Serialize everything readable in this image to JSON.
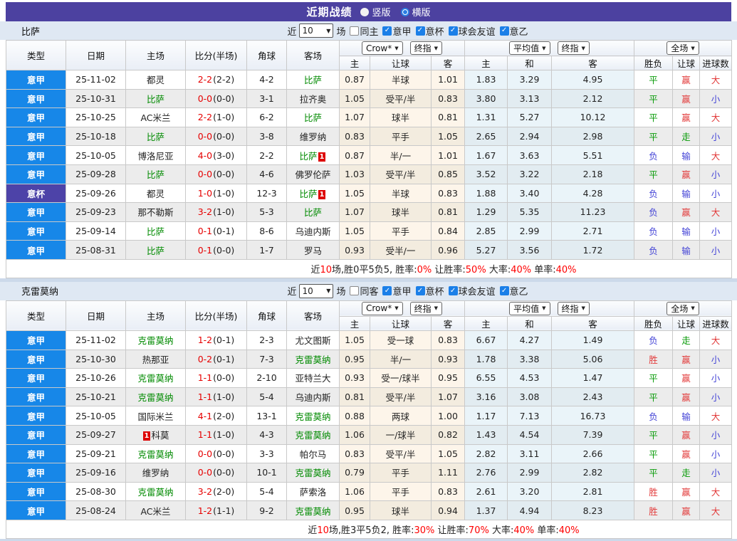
{
  "title_bar": {
    "title": "近期战绩",
    "radios": [
      {
        "label": "竖版",
        "checked": false,
        "name": "vertical-layout-radio"
      },
      {
        "label": "横版",
        "checked": true,
        "name": "horizontal-layout-radio"
      }
    ]
  },
  "colors": {
    "header_purple": "#4c41a0",
    "league_serie_a_blue": "#1787e8",
    "league_cup_purple": "#4d43a8",
    "focal_team_green": "#008a00",
    "score_red": "#e60000",
    "outcome_red": "#e23b3b",
    "outcome_green": "#089b08",
    "outcome_blue": "#4343d6",
    "outcome_map": {
      "胜": "r",
      "赢": "r",
      "大": "r",
      "平": "g",
      "走": "g",
      "负": "b",
      "输": "b",
      "小": "b"
    }
  },
  "tables": [
    {
      "team": "比萨",
      "filter": {
        "near_label": "近",
        "count": "10",
        "games_label": "场",
        "same_label": "同主",
        "leagues": [
          "意甲",
          "意杯",
          "球会友谊",
          "意乙"
        ]
      },
      "header": {
        "cols": [
          "类型",
          "日期",
          "主场",
          "比分(半场)",
          "角球",
          "客场"
        ],
        "dd": [
          "Crow*",
          "终指",
          "平均值",
          "终指",
          "全场"
        ],
        "sub": [
          "主",
          "让球",
          "客",
          "主",
          "和",
          "客",
          "胜负",
          "让球",
          "进球数"
        ]
      },
      "rows": [
        {
          "league": "意甲",
          "date": "25-11-02",
          "home": {
            "name": "都灵"
          },
          "ft": "2-2",
          "ht": "(2-2)",
          "corner": "4-2",
          "away": {
            "name": "比萨",
            "focal": true
          },
          "crow": [
            "0.87",
            "半球",
            "1.01"
          ],
          "avg": [
            "1.83",
            "3.29",
            "4.95"
          ],
          "full": [
            "平",
            "赢",
            "大"
          ]
        },
        {
          "league": "意甲",
          "date": "25-10-31",
          "home": {
            "name": "比萨",
            "focal": true
          },
          "ft": "0-0",
          "ht": "(0-0)",
          "corner": "3-1",
          "away": {
            "name": "拉齐奥"
          },
          "crow": [
            "1.05",
            "受平/半",
            "0.83"
          ],
          "avg": [
            "3.80",
            "3.13",
            "2.12"
          ],
          "full": [
            "平",
            "赢",
            "小"
          ]
        },
        {
          "league": "意甲",
          "date": "25-10-25",
          "home": {
            "name": "AC米兰"
          },
          "ft": "2-2",
          "ht": "(1-0)",
          "corner": "6-2",
          "away": {
            "name": "比萨",
            "focal": true
          },
          "crow": [
            "1.07",
            "球半",
            "0.81"
          ],
          "avg": [
            "1.31",
            "5.27",
            "10.12"
          ],
          "full": [
            "平",
            "赢",
            "大"
          ]
        },
        {
          "league": "意甲",
          "date": "25-10-18",
          "home": {
            "name": "比萨",
            "focal": true
          },
          "ft": "0-0",
          "ht": "(0-0)",
          "corner": "3-8",
          "away": {
            "name": "维罗纳"
          },
          "crow": [
            "0.83",
            "平手",
            "1.05"
          ],
          "avg": [
            "2.65",
            "2.94",
            "2.98"
          ],
          "full": [
            "平",
            "走",
            "小"
          ]
        },
        {
          "league": "意甲",
          "date": "25-10-05",
          "home": {
            "name": "博洛尼亚"
          },
          "ft": "4-0",
          "ht": "(3-0)",
          "corner": "2-2",
          "away": {
            "name": "比萨",
            "focal": true,
            "badge": "1",
            "badge_pos": "after"
          },
          "crow": [
            "0.87",
            "半/一",
            "1.01"
          ],
          "avg": [
            "1.67",
            "3.63",
            "5.51"
          ],
          "full": [
            "负",
            "输",
            "大"
          ]
        },
        {
          "league": "意甲",
          "date": "25-09-28",
          "home": {
            "name": "比萨",
            "focal": true
          },
          "ft": "0-0",
          "ht": "(0-0)",
          "corner": "4-6",
          "away": {
            "name": "佛罗伦萨"
          },
          "crow": [
            "1.03",
            "受平/半",
            "0.85"
          ],
          "avg": [
            "3.52",
            "3.22",
            "2.18"
          ],
          "full": [
            "平",
            "赢",
            "小"
          ]
        },
        {
          "league": "意杯",
          "date": "25-09-26",
          "home": {
            "name": "都灵"
          },
          "ft": "1-0",
          "ht": "(1-0)",
          "corner": "12-3",
          "away": {
            "name": "比萨",
            "focal": true,
            "badge": "1",
            "badge_pos": "after"
          },
          "crow": [
            "1.05",
            "半球",
            "0.83"
          ],
          "avg": [
            "1.88",
            "3.40",
            "4.28"
          ],
          "full": [
            "负",
            "输",
            "小"
          ]
        },
        {
          "league": "意甲",
          "date": "25-09-23",
          "home": {
            "name": "那不勒斯"
          },
          "ft": "3-2",
          "ht": "(1-0)",
          "corner": "5-3",
          "away": {
            "name": "比萨",
            "focal": true
          },
          "crow": [
            "1.07",
            "球半",
            "0.81"
          ],
          "avg": [
            "1.29",
            "5.35",
            "11.23"
          ],
          "full": [
            "负",
            "赢",
            "大"
          ]
        },
        {
          "league": "意甲",
          "date": "25-09-14",
          "home": {
            "name": "比萨",
            "focal": true
          },
          "ft": "0-1",
          "ht": "(0-1)",
          "corner": "8-6",
          "away": {
            "name": "乌迪内斯"
          },
          "crow": [
            "1.05",
            "平手",
            "0.84"
          ],
          "avg": [
            "2.85",
            "2.99",
            "2.71"
          ],
          "full": [
            "负",
            "输",
            "小"
          ]
        },
        {
          "league": "意甲",
          "date": "25-08-31",
          "home": {
            "name": "比萨",
            "focal": true
          },
          "ft": "0-1",
          "ht": "(0-0)",
          "corner": "1-7",
          "away": {
            "name": "罗马"
          },
          "crow": [
            "0.93",
            "受半/一",
            "0.96"
          ],
          "avg": [
            "5.27",
            "3.56",
            "1.72"
          ],
          "full": [
            "负",
            "输",
            "小"
          ]
        }
      ],
      "summary": [
        {
          "t": "近",
          "red": false
        },
        {
          "t": "10",
          "red": true
        },
        {
          "t": "场,胜0平5负5, 胜率:",
          "red": false
        },
        {
          "t": "0%",
          "red": true
        },
        {
          "t": " 让胜率:",
          "red": false
        },
        {
          "t": "50%",
          "red": true
        },
        {
          "t": " 大率:",
          "red": false
        },
        {
          "t": "40%",
          "red": true
        },
        {
          "t": " 单率:",
          "red": false
        },
        {
          "t": "40%",
          "red": true
        }
      ]
    },
    {
      "team": "克雷莫纳",
      "filter": {
        "near_label": "近",
        "count": "10",
        "games_label": "场",
        "same_label": "同客",
        "leagues": [
          "意甲",
          "意杯",
          "球会友谊",
          "意乙"
        ]
      },
      "header": {
        "cols": [
          "类型",
          "日期",
          "主场",
          "比分(半场)",
          "角球",
          "客场"
        ],
        "dd": [
          "Crow*",
          "终指",
          "平均值",
          "终指",
          "全场"
        ],
        "sub": [
          "主",
          "让球",
          "客",
          "主",
          "和",
          "客",
          "胜负",
          "让球",
          "进球数"
        ]
      },
      "rows": [
        {
          "league": "意甲",
          "date": "25-11-02",
          "home": {
            "name": "克雷莫纳",
            "focal": true
          },
          "ft": "1-2",
          "ht": "(0-1)",
          "corner": "2-3",
          "away": {
            "name": "尤文图斯"
          },
          "crow": [
            "1.05",
            "受一球",
            "0.83"
          ],
          "avg": [
            "6.67",
            "4.27",
            "1.49"
          ],
          "full": [
            "负",
            "走",
            "大"
          ]
        },
        {
          "league": "意甲",
          "date": "25-10-30",
          "home": {
            "name": "热那亚"
          },
          "ft": "0-2",
          "ht": "(0-1)",
          "corner": "7-3",
          "away": {
            "name": "克雷莫纳",
            "focal": true
          },
          "crow": [
            "0.95",
            "半/一",
            "0.93"
          ],
          "avg": [
            "1.78",
            "3.38",
            "5.06"
          ],
          "full": [
            "胜",
            "赢",
            "小"
          ]
        },
        {
          "league": "意甲",
          "date": "25-10-26",
          "home": {
            "name": "克雷莫纳",
            "focal": true
          },
          "ft": "1-1",
          "ht": "(0-0)",
          "corner": "2-10",
          "away": {
            "name": "亚特兰大"
          },
          "crow": [
            "0.93",
            "受一/球半",
            "0.95"
          ],
          "avg": [
            "6.55",
            "4.53",
            "1.47"
          ],
          "full": [
            "平",
            "赢",
            "小"
          ]
        },
        {
          "league": "意甲",
          "date": "25-10-21",
          "home": {
            "name": "克雷莫纳",
            "focal": true
          },
          "ft": "1-1",
          "ht": "(1-0)",
          "corner": "5-4",
          "away": {
            "name": "乌迪内斯"
          },
          "crow": [
            "0.81",
            "受平/半",
            "1.07"
          ],
          "avg": [
            "3.16",
            "3.08",
            "2.43"
          ],
          "full": [
            "平",
            "赢",
            "小"
          ]
        },
        {
          "league": "意甲",
          "date": "25-10-05",
          "home": {
            "name": "国际米兰"
          },
          "ft": "4-1",
          "ht": "(2-0)",
          "corner": "13-1",
          "away": {
            "name": "克雷莫纳",
            "focal": true
          },
          "crow": [
            "0.88",
            "两球",
            "1.00"
          ],
          "avg": [
            "1.17",
            "7.13",
            "16.73"
          ],
          "full": [
            "负",
            "输",
            "大"
          ]
        },
        {
          "league": "意甲",
          "date": "25-09-27",
          "home": {
            "name": "科莫",
            "badge": "1",
            "badge_pos": "before"
          },
          "ft": "1-1",
          "ht": "(1-0)",
          "corner": "4-3",
          "away": {
            "name": "克雷莫纳",
            "focal": true
          },
          "crow": [
            "1.06",
            "一/球半",
            "0.82"
          ],
          "avg": [
            "1.43",
            "4.54",
            "7.39"
          ],
          "full": [
            "平",
            "赢",
            "小"
          ]
        },
        {
          "league": "意甲",
          "date": "25-09-21",
          "home": {
            "name": "克雷莫纳",
            "focal": true
          },
          "ft": "0-0",
          "ht": "(0-0)",
          "corner": "3-3",
          "away": {
            "name": "帕尔马"
          },
          "crow": [
            "0.83",
            "受平/半",
            "1.05"
          ],
          "avg": [
            "2.82",
            "3.11",
            "2.66"
          ],
          "full": [
            "平",
            "赢",
            "小"
          ]
        },
        {
          "league": "意甲",
          "date": "25-09-16",
          "home": {
            "name": "维罗纳"
          },
          "ft": "0-0",
          "ht": "(0-0)",
          "corner": "10-1",
          "away": {
            "name": "克雷莫纳",
            "focal": true
          },
          "crow": [
            "0.79",
            "平手",
            "1.11"
          ],
          "avg": [
            "2.76",
            "2.99",
            "2.82"
          ],
          "full": [
            "平",
            "走",
            "小"
          ]
        },
        {
          "league": "意甲",
          "date": "25-08-30",
          "home": {
            "name": "克雷莫纳",
            "focal": true
          },
          "ft": "3-2",
          "ht": "(2-0)",
          "corner": "5-4",
          "away": {
            "name": "萨索洛"
          },
          "crow": [
            "1.06",
            "平手",
            "0.83"
          ],
          "avg": [
            "2.61",
            "3.20",
            "2.81"
          ],
          "full": [
            "胜",
            "赢",
            "大"
          ]
        },
        {
          "league": "意甲",
          "date": "25-08-24",
          "home": {
            "name": "AC米兰"
          },
          "ft": "1-2",
          "ht": "(1-1)",
          "corner": "9-2",
          "away": {
            "name": "克雷莫纳",
            "focal": true
          },
          "crow": [
            "0.95",
            "球半",
            "0.94"
          ],
          "avg": [
            "1.37",
            "4.94",
            "8.23"
          ],
          "full": [
            "胜",
            "赢",
            "大"
          ]
        }
      ],
      "summary": [
        {
          "t": "近",
          "red": false
        },
        {
          "t": "10",
          "red": true
        },
        {
          "t": "场,胜3平5负2, 胜率:",
          "red": false
        },
        {
          "t": "30%",
          "red": true
        },
        {
          "t": " 让胜率:",
          "red": false
        },
        {
          "t": "70%",
          "red": true
        },
        {
          "t": " 大率:",
          "red": false
        },
        {
          "t": "40%",
          "red": true
        },
        {
          "t": " 单率:",
          "red": false
        },
        {
          "t": "40%",
          "red": true
        }
      ]
    }
  ]
}
